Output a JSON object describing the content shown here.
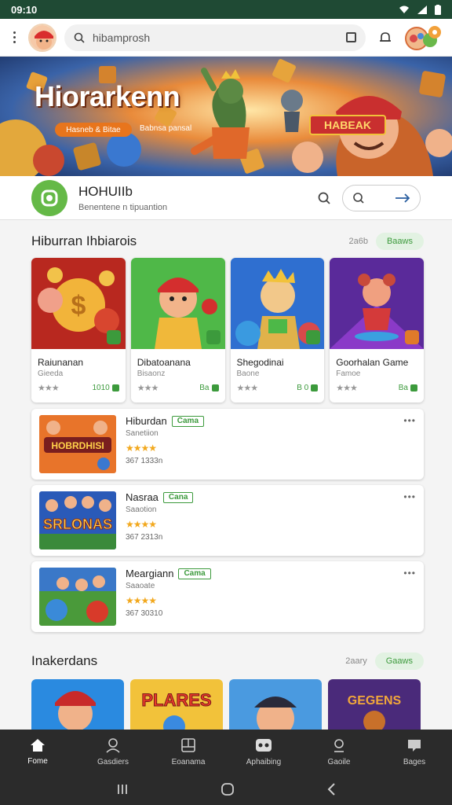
{
  "status_bar": {
    "time": "09:10"
  },
  "search": {
    "placeholder": "hibamprosh"
  },
  "banner": {
    "title": "Hiorarkenn",
    "pill_label": "Hasneb & Bitae",
    "subtitle": "Babnsa pansal",
    "sign_text": "HABEAK"
  },
  "app_info": {
    "title": "HOHUIIb",
    "subtitle": "Benentene n tipuantion"
  },
  "section1": {
    "title": "Hiburran Ihbiarois",
    "count": "2a6b",
    "pill": "Baaws"
  },
  "cards": [
    {
      "name": "Raiunanan",
      "sub": "Gieeda",
      "rating": 3,
      "stars_grey": true,
      "num": "1010"
    },
    {
      "name": "Dibatoanana",
      "sub": "Bisaonz",
      "rating": 2,
      "stars_grey": true,
      "num": "Ba"
    },
    {
      "name": "Shegodinai",
      "sub": "Baone",
      "rating": 2,
      "stars_grey": true,
      "num": "B 0"
    },
    {
      "name": "Goorhalan Game",
      "sub": "Famoe",
      "rating": 2,
      "stars_grey": true,
      "num": "Ba"
    }
  ],
  "list": [
    {
      "title": "Hiburdan",
      "tag": "Cama",
      "sub": "Sanetiion",
      "rating": 4,
      "meta": "367 1333n"
    },
    {
      "title": "Nasraa",
      "tag": "Cana",
      "sub": "Saaotion",
      "rating": 4,
      "meta": "367 2313n"
    },
    {
      "title": "Meargiann",
      "tag": "Cama",
      "sub": "Saaoate",
      "rating": 4,
      "meta": "367 30310"
    }
  ],
  "section2": {
    "title": "Inakerdans",
    "count": "2aary",
    "pill": "Gaaws"
  },
  "bottom_nav": [
    {
      "label": "Fome",
      "icon": "home-icon"
    },
    {
      "label": "Gasdiers",
      "icon": "person-icon"
    },
    {
      "label": "Eoanama",
      "icon": "gallery-icon"
    },
    {
      "label": "Aphaibing",
      "icon": "gamepad-icon"
    },
    {
      "label": "Gaoile",
      "icon": "profile-icon"
    },
    {
      "label": "Bages",
      "icon": "bag-icon"
    }
  ]
}
